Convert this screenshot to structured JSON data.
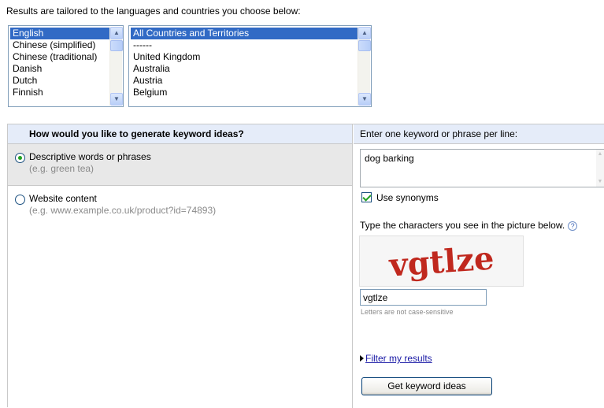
{
  "intro_text": "Results are tailored to the languages and countries you choose below:",
  "languages": [
    {
      "label": "English",
      "selected": true
    },
    {
      "label": "Chinese (simplified)",
      "selected": false
    },
    {
      "label": "Chinese (traditional)",
      "selected": false
    },
    {
      "label": "Danish",
      "selected": false
    },
    {
      "label": "Dutch",
      "selected": false
    },
    {
      "label": "Finnish",
      "selected": false
    }
  ],
  "countries": [
    {
      "label": "All Countries and Territories",
      "selected": true
    },
    {
      "label": "------",
      "selected": false
    },
    {
      "label": "United Kingdom",
      "selected": false
    },
    {
      "label": "Australia",
      "selected": false
    },
    {
      "label": "Austria",
      "selected": false
    },
    {
      "label": "Belgium",
      "selected": false
    }
  ],
  "method": {
    "header": "How would you like to generate keyword ideas?",
    "options": [
      {
        "label": "Descriptive words or phrases",
        "example": "(e.g. green tea)",
        "selected": true
      },
      {
        "label": "Website content",
        "example": "(e.g. www.example.co.uk/product?id=74893)",
        "selected": false
      }
    ]
  },
  "keywords": {
    "header": "Enter one keyword or phrase per line:",
    "value": "dog barking",
    "use_synonyms_label": "Use synonyms",
    "use_synonyms_checked": true
  },
  "captcha": {
    "prompt": "Type the characters you see in the picture below.",
    "help_glyph": "?",
    "image_text": "vgtlze",
    "input_value": "vgtlze",
    "note": "Letters are not case-sensitive"
  },
  "filter_link": "Filter my results",
  "submit_label": "Get keyword ideas",
  "colors": {
    "selection": "#316ac5",
    "header_bg": "#e5ecf9",
    "captcha_text": "#c0281e",
    "link": "#1a1aa6"
  }
}
